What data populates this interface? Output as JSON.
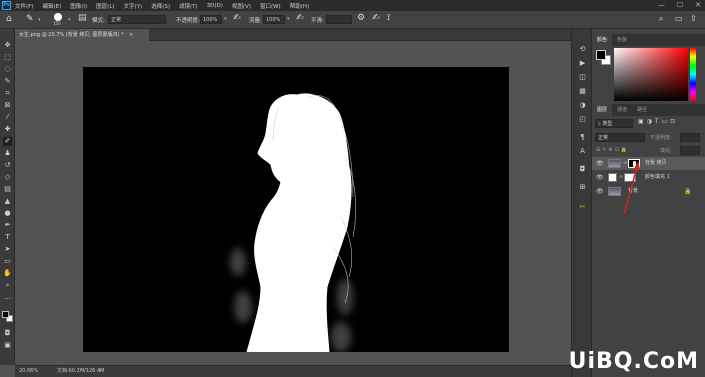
{
  "app": {
    "logo": "Ps"
  },
  "menu": [
    "文件(F)",
    "编辑(E)",
    "图像(I)",
    "图层(L)",
    "文字(Y)",
    "选择(S)",
    "滤镜(T)",
    "3D(D)",
    "视图(V)",
    "窗口(W)",
    "帮助(H)"
  ],
  "window_controls": {
    "minimize": "—",
    "maximize": "☐",
    "close": "✕"
  },
  "options": {
    "size": "150",
    "mode_label": "模式:",
    "mode_value": "正常",
    "opacity_label": "不透明度:",
    "opacity_value": "100%",
    "flow_label": "流量:",
    "flow_value": "100%",
    "smooth_label": "平滑:"
  },
  "document_tab": {
    "title": "女生.png @ 20.7% (背景 拷贝, 图层蒙版/8) *",
    "close": "×"
  },
  "status": {
    "zoom": "20.66%",
    "doc": "文档:60.2M/126.4M"
  },
  "color_panel": {
    "tabs": [
      "颜色",
      "色板"
    ],
    "accent": "#ff0000"
  },
  "layers_panel": {
    "tabs": [
      "图层",
      "通道",
      "路径"
    ],
    "filter_kind": "类型",
    "blend_mode": "正常",
    "opacity_label": "不透明度:",
    "fill_label": "填充:",
    "layers": [
      {
        "name": "背景 拷贝",
        "selected": true
      },
      {
        "name": "颜色填充 1",
        "selected": false
      },
      {
        "name": "背景",
        "selected": false,
        "locked": true
      }
    ]
  },
  "watermark": "UiBQ.CoM"
}
